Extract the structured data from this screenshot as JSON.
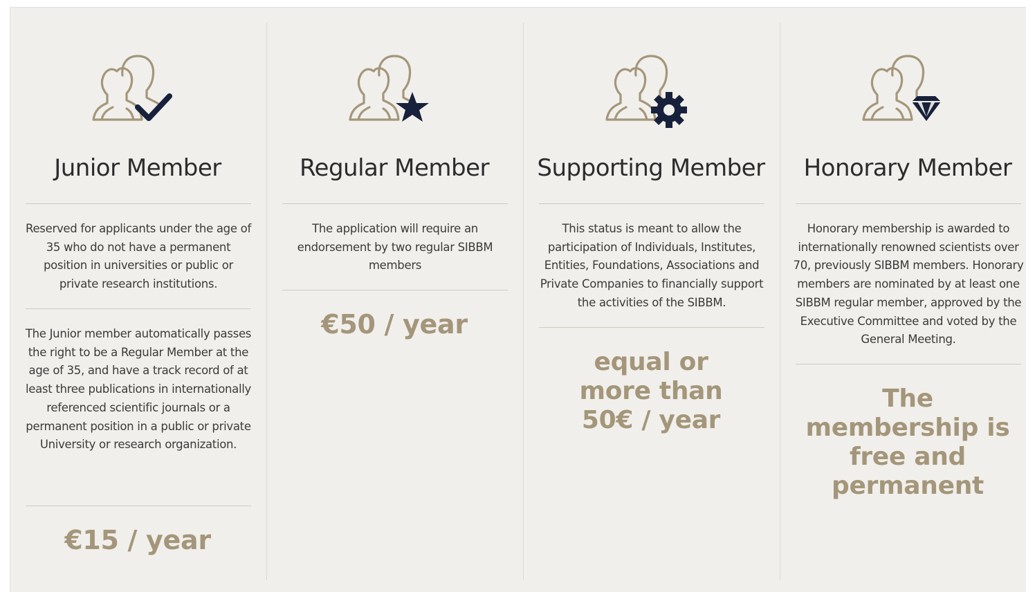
{
  "colors": {
    "background": "#f1efeb",
    "gold": "#a4967a",
    "icon_outline": "#a4967a",
    "icon_badge": "#17213b",
    "title": "#2b2b2b",
    "divider": "#cfcac1"
  },
  "members": [
    {
      "icon": "people-check-icon",
      "title": "Junior Member",
      "description": "Reserved for applicants under the age of 35 who do not have a permanent position in universities or public or private research institutions.",
      "note": "The Junior member automatically passes the right to be a Regular Member at the age of 35, and have a track record of at least three publications in internationally referenced scientific journals or a permanent position in a public or private University or research organization.",
      "price": "€15 / year"
    },
    {
      "icon": "people-star-icon",
      "title": "Regular Member",
      "description": "The application will require an endorsement by two regular SIBBM members",
      "price": "€50 / year"
    },
    {
      "icon": "people-gear-icon",
      "title": "Supporting Member",
      "description": "This status is meant to allow the participation of Individuals, Institutes, Entities, Foundations, Associations and Private Companies to financially support the activities of the SIBBM.",
      "price": "equal or more than 50€ / year"
    },
    {
      "icon": "people-diamond-icon",
      "title": "Honorary Member",
      "description": "Honorary membership is awarded to internationally renowned scientists over 70, previously SIBBM members. Honorary members are nominated by at least one SIBBM regular member, approved by the Executive Committee and voted by the General Meeting.",
      "price": "The membership is free and permanent"
    }
  ]
}
